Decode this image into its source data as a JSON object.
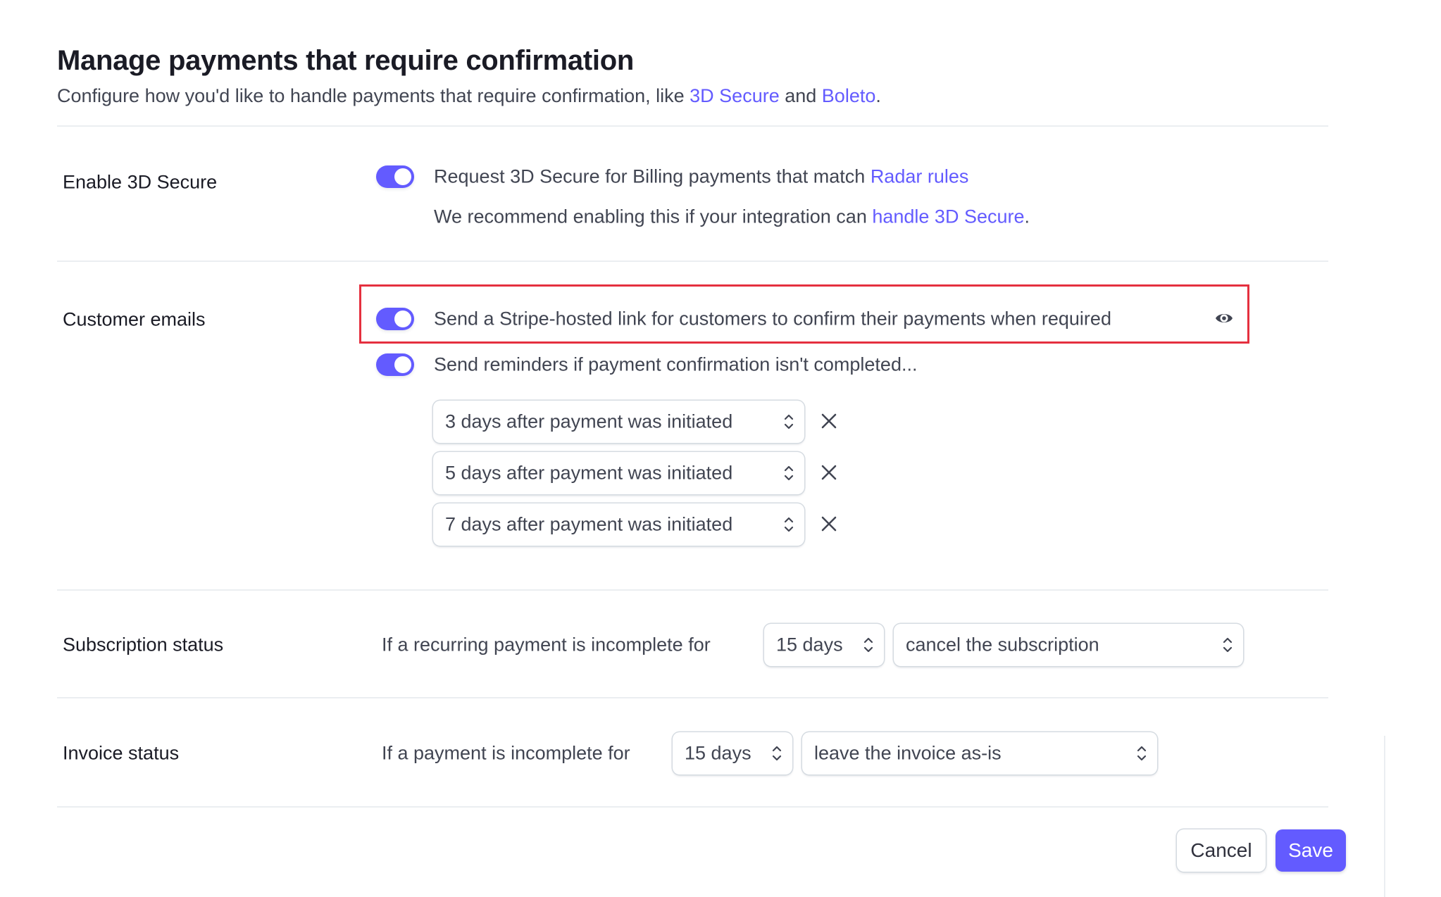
{
  "header": {
    "title": "Manage payments that require confirmation",
    "subtitle_prefix": "Configure how you'd like to handle payments that require confirmation, like ",
    "subtitle_link1": "3D Secure",
    "subtitle_mid": " and ",
    "subtitle_link2": "Boleto",
    "subtitle_suffix": "."
  },
  "sections": {
    "three_d_secure": {
      "label": "Enable 3D Secure",
      "toggle_on": true,
      "line1_prefix": "Request 3D Secure for Billing payments that match ",
      "line1_link": "Radar rules",
      "line2_prefix": "We recommend enabling this if your integration can ",
      "line2_link": "handle 3D Secure",
      "line2_suffix": "."
    },
    "customer_emails": {
      "label": "Customer emails",
      "hosted_link": {
        "toggle_on": true,
        "text": "Send a Stripe-hosted link for customers to confirm their payments when required",
        "icon": "eye-icon"
      },
      "reminders": {
        "toggle_on": true,
        "text": "Send reminders if payment confirmation isn't completed...",
        "items": [
          {
            "value": "3 days after payment was initiated"
          },
          {
            "value": "5 days after payment was initiated"
          },
          {
            "value": "7 days after payment was initiated"
          }
        ]
      }
    },
    "subscription_status": {
      "label": "Subscription status",
      "prefix": "If a recurring payment is incomplete for",
      "duration": "15 days",
      "action": "cancel the subscription"
    },
    "invoice_status": {
      "label": "Invoice status",
      "prefix": "If a payment is incomplete for",
      "duration": "15 days",
      "action": "leave the invoice as-is"
    }
  },
  "footer": {
    "cancel_label": "Cancel",
    "save_label": "Save"
  },
  "colors": {
    "accent": "#635bff",
    "highlight": "#e5303f"
  }
}
